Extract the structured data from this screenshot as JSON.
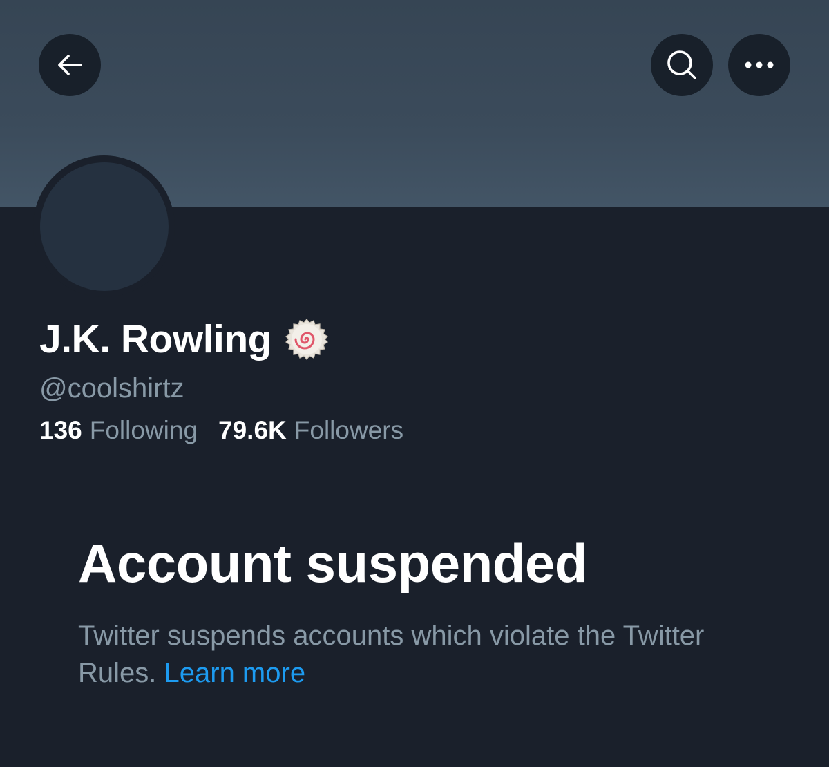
{
  "header": {
    "back_icon": "arrow-left-icon",
    "search_icon": "search-icon",
    "more_icon": "more-horizontal-icon"
  },
  "profile": {
    "display_name": "J.K. Rowling",
    "badge_icon": "narutomaki-emoji-icon",
    "handle": "@coolshirtz",
    "following_count": "136",
    "following_label": "Following",
    "followers_count": "79.6K",
    "followers_label": "Followers"
  },
  "suspension": {
    "title": "Account suspended",
    "description": "Twitter suspends accounts which violate the Twitter Rules.",
    "learn_more_label": "Learn more"
  },
  "colors": {
    "background": "#1a202b",
    "banner": "#3b4b5b",
    "primary_text": "#ffffff",
    "secondary_text": "#8899a6",
    "link": "#1d9bf0"
  }
}
